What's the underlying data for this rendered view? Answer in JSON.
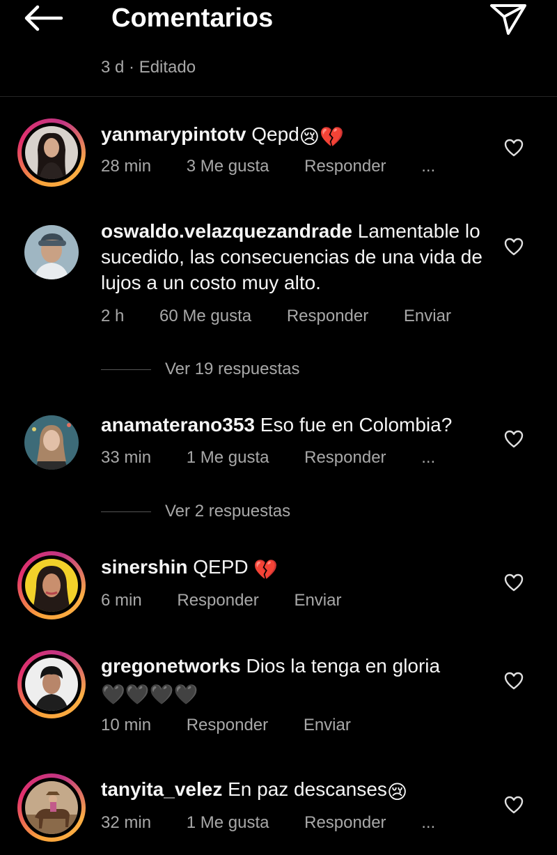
{
  "header": {
    "title": "Comentarios",
    "meta": "3 d · Editado"
  },
  "colors": {
    "background": "#000000",
    "text": "#f5f5f5",
    "secondary": "#a8a8a8",
    "story_ring": "#e1306c"
  },
  "icons": {
    "back": "arrow-left-icon",
    "share": "paper-plane-icon",
    "like": "heart-outline-icon"
  },
  "comments": [
    {
      "user": "yanmarypintotv",
      "text": "Qepd",
      "emojis": "😢💔",
      "time": "28 min",
      "likes": "3 Me gusta",
      "reply": "Responder",
      "extra": "...",
      "ring": true
    },
    {
      "user": "oswaldo.velazquezandrade",
      "text": "Lamentable lo sucedido, las consecuencias de una vida de lujos a un costo muy alto.",
      "time": "2 h",
      "likes": "60 Me gusta",
      "reply": "Responder",
      "extra": "Enviar",
      "replies": "Ver 19 respuestas",
      "ring": false
    },
    {
      "user": "anamaterano353",
      "text": "Eso fue en Colombia?",
      "time": "33 min",
      "likes": "1 Me gusta",
      "reply": "Responder",
      "extra": "...",
      "replies": "Ver 2 respuestas",
      "ring": false
    },
    {
      "user": "sinershin",
      "text": "QEPD",
      "emojis": "💔",
      "time": "6 min",
      "reply": "Responder",
      "extra": "Enviar",
      "ring": true
    },
    {
      "user": "gregonetworks",
      "text": "Dios la tenga en gloria",
      "emojis": "🖤🖤🖤🖤",
      "time": "10 min",
      "reply": "Responder",
      "extra": "Enviar",
      "ring": true
    },
    {
      "user": "tanyita_velez",
      "text": "En paz descanses",
      "emojis": "😢",
      "time": "32 min",
      "likes": "1 Me gusta",
      "reply": "Responder",
      "extra": "...",
      "ring": true
    }
  ]
}
